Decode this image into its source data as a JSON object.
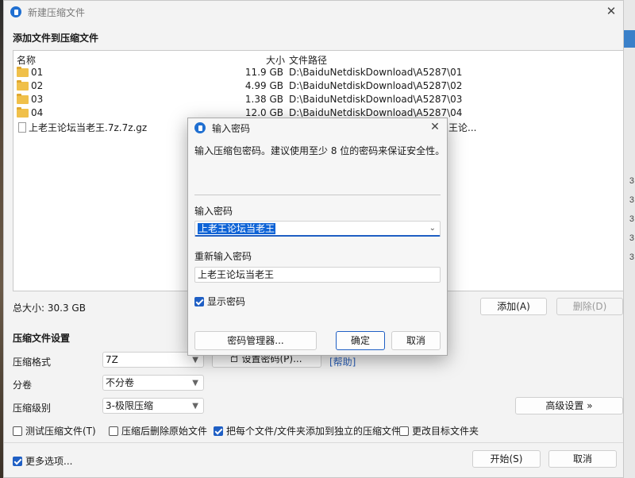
{
  "main_window": {
    "title": "新建压缩文件",
    "add_files_title": "添加文件到压缩文件",
    "columns": {
      "name": "名称",
      "size": "大小",
      "path": "文件路径"
    },
    "files": [
      {
        "name": "01",
        "size": "11.9 GB",
        "path": "D:\\BaiduNetdiskDownload\\A5287\\01",
        "icon": "folder-icon"
      },
      {
        "name": "02",
        "size": "4.99 GB",
        "path": "D:\\BaiduNetdiskDownload\\A5287\\02",
        "icon": "folder-icon"
      },
      {
        "name": "03",
        "size": "1.38 GB",
        "path": "D:\\BaiduNetdiskDownload\\A5287\\03",
        "icon": "folder-icon"
      },
      {
        "name": "04",
        "size": "12.0 GB",
        "path": "D:\\BaiduNetdiskDownload\\A5287\\04",
        "icon": "folder-icon"
      },
      {
        "name": "上老王论坛当老王.7z.7z.gz",
        "size": "",
        "path": "王论...",
        "icon": "file-icon"
      }
    ],
    "total_size": "总大小: 30.3 GB",
    "add_button": "添加(A)",
    "remove_button": "删除(D)",
    "settings_title": "压缩文件设置",
    "format_label": "压缩格式",
    "format_value": "7Z",
    "volume_label": "分卷",
    "volume_value": "不分卷",
    "level_label": "压缩级别",
    "level_value": "3-极限压缩",
    "set_password_button": "设置密码(P)...",
    "help_link": "[帮助]",
    "advanced_button": "高级设置 »",
    "checkboxes": {
      "test": "测试压缩文件(T)",
      "delete_source": "压缩后删除原始文件",
      "separate": "把每个文件/文件夹添加到独立的压缩文件",
      "change_target": "更改目标文件夹"
    },
    "more_options": "更多选项...",
    "start_button": "开始(S)",
    "cancel_button": "取消"
  },
  "password_dialog": {
    "title": "输入密码",
    "message": "输入压缩包密码。建议使用至少 8 位的密码来保证安全性。",
    "password_label": "输入密码",
    "password_value": "上老王论坛当老王",
    "confirm_label": "重新输入密码",
    "confirm_value": "上老王论坛当老王",
    "show_password": "显示密码",
    "manager_button": "密码管理器...",
    "ok_button": "确定",
    "cancel_button": "取消"
  },
  "background_right_numbers": [
    "3",
    "3",
    "3",
    "3",
    "3"
  ],
  "colors": {
    "accent": "#1f5fc4",
    "folder": "#f0c04a",
    "link": "#2a5fb8"
  }
}
